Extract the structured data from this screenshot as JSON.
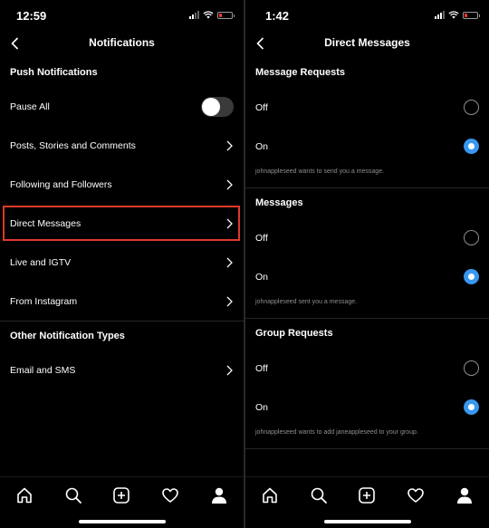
{
  "left": {
    "status": {
      "time": "12:59"
    },
    "nav": {
      "title": "Notifications"
    },
    "push_header": "Push Notifications",
    "rows": [
      {
        "label": "Pause All"
      },
      {
        "label": "Posts, Stories and Comments"
      },
      {
        "label": "Following and Followers"
      },
      {
        "label": "Direct Messages"
      },
      {
        "label": "Live and IGTV"
      },
      {
        "label": "From Instagram"
      }
    ],
    "other_header": "Other Notification Types",
    "email_row": {
      "label": "Email and SMS"
    }
  },
  "right": {
    "status": {
      "time": "1:42"
    },
    "nav": {
      "title": "Direct Messages"
    },
    "groups": [
      {
        "header": "Message Requests",
        "off": "Off",
        "on": "On",
        "selected": "On",
        "caption": "johnappleseed wants to send you a message."
      },
      {
        "header": "Messages",
        "off": "Off",
        "on": "On",
        "selected": "On",
        "caption": "johnappleseed sent you a message."
      },
      {
        "header": "Group Requests",
        "off": "Off",
        "on": "On",
        "selected": "On",
        "caption": "johnappleseed wants to add janeappleseed to your group."
      }
    ]
  },
  "tabbar": {
    "icons": [
      "home-icon",
      "search-icon",
      "new-post-icon",
      "activity-heart-icon",
      "profile-icon"
    ]
  },
  "colors": {
    "highlight": "#e0392b",
    "accent": "#3897f0",
    "battery_low": "#ff3b30"
  }
}
